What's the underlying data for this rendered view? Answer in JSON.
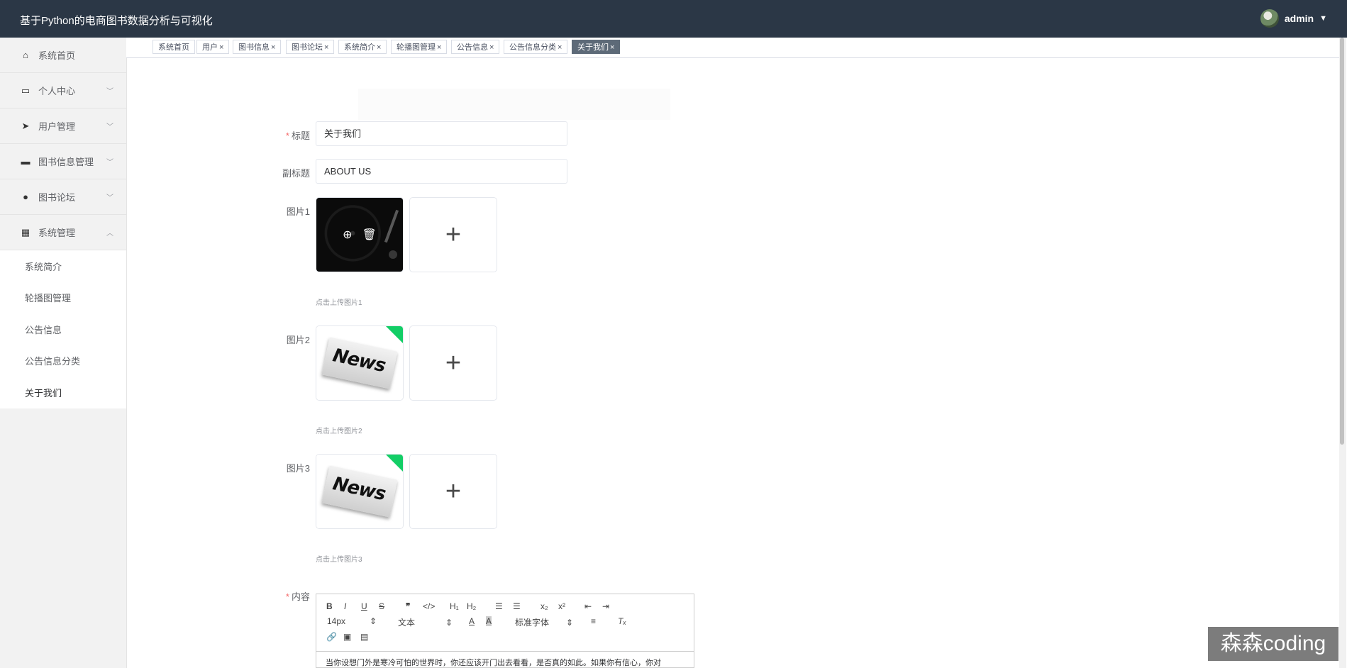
{
  "app": {
    "title": "基于Python的电商图书数据分析与可视化"
  },
  "user": {
    "name": "admin"
  },
  "sidebar": {
    "items": [
      {
        "label": "系统首页",
        "icon": "home-icon"
      },
      {
        "label": "个人中心",
        "icon": "card-icon"
      },
      {
        "label": "用户管理",
        "icon": "send-icon"
      },
      {
        "label": "图书信息管理",
        "icon": "monitor-icon"
      },
      {
        "label": "图书论坛",
        "icon": "user-icon"
      },
      {
        "label": "系统管理",
        "icon": "grid-icon"
      }
    ],
    "subitems": [
      "系统简介",
      "轮播图管理",
      "公告信息",
      "公告信息分类",
      "关于我们"
    ]
  },
  "tabs": [
    "系统首页",
    "用户",
    "图书信息",
    "图书论坛",
    "系统简介",
    "轮播图管理",
    "公告信息",
    "公告信息分类",
    "关于我们"
  ],
  "form": {
    "title_label": "标题",
    "title_value": "关于我们",
    "subtitle_label": "副标题",
    "subtitle_value": "ABOUT US",
    "image1_label": "图片1",
    "image1_hint": "点击上传图片1",
    "image2_label": "图片2",
    "image2_hint": "点击上传图片2",
    "image3_label": "图片3",
    "image3_hint": "点击上传图片3",
    "content_label": "内容",
    "news_text": "News"
  },
  "editor": {
    "font_size": "14px",
    "text_style": "文本",
    "font_family": "标准字体",
    "content": "当你设想门外是寒冷可怕的世界时，你还应该开门出去看看，是否真的如此。如果你有信心，你对"
  },
  "watermark": "森森coding",
  "colors": {
    "topbar": "#2b3746",
    "accent": "#13ce66",
    "active_tab": "#5d6a78"
  }
}
